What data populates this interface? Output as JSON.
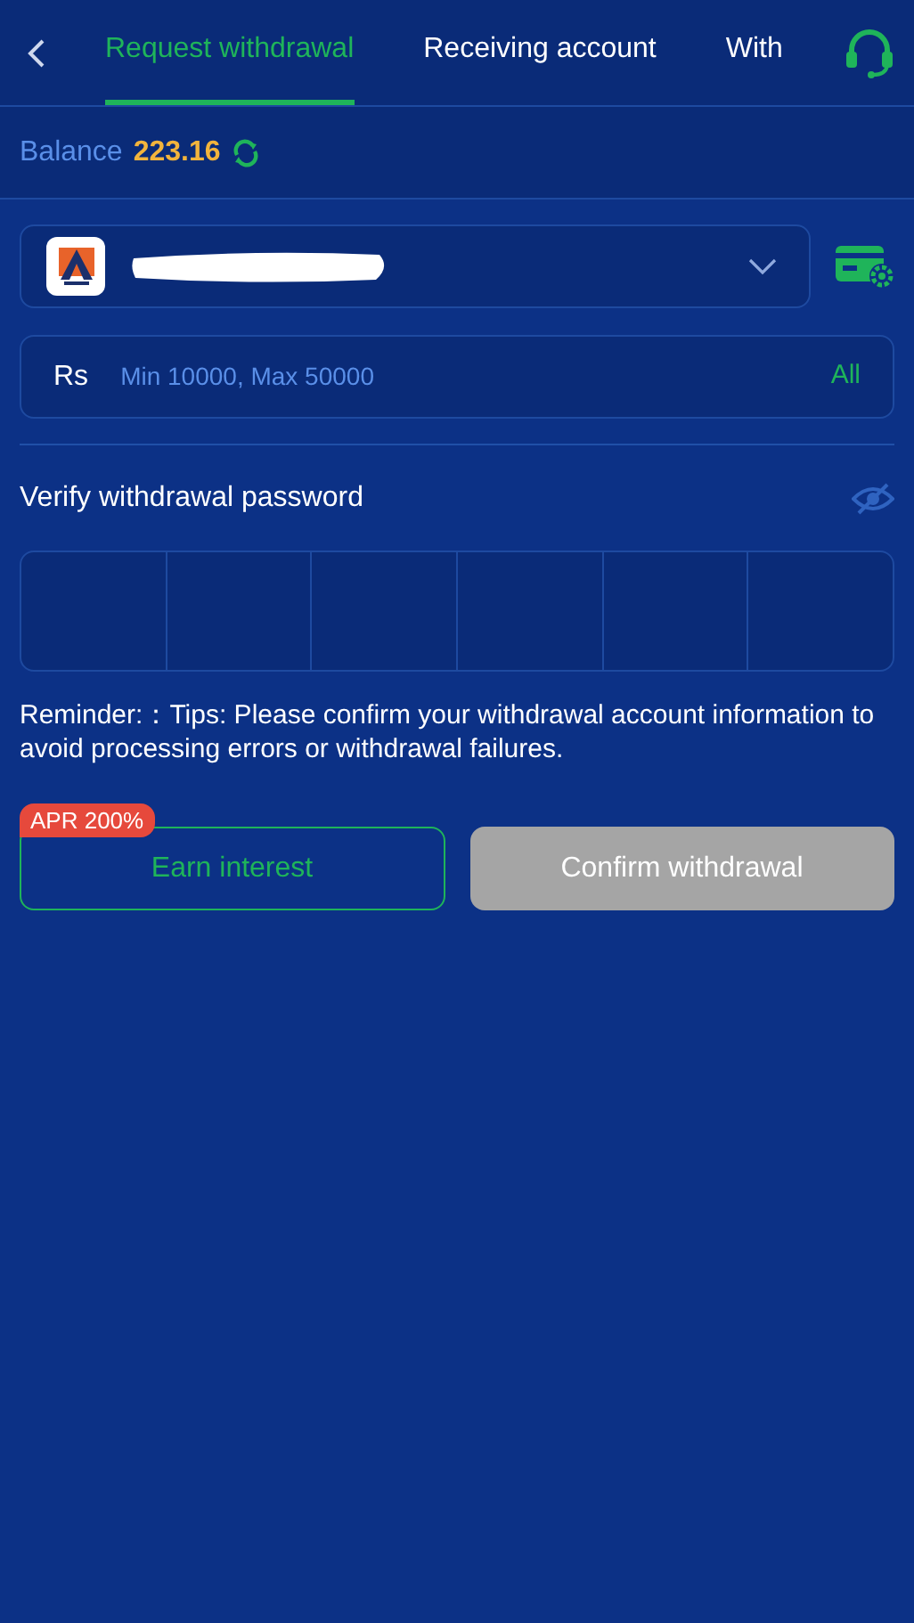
{
  "header": {
    "tabs": [
      {
        "label": "Request withdrawal",
        "selected": true
      },
      {
        "label": "Receiving account",
        "selected": false
      },
      {
        "label": "With",
        "selected": false
      }
    ]
  },
  "balance": {
    "label": "Balance",
    "amount": "223.16"
  },
  "account": {
    "redacted": true
  },
  "amount_field": {
    "currency": "Rs",
    "placeholder": "Min 10000, Max 50000",
    "all_label": "All"
  },
  "password": {
    "label": "Verify withdrawal password",
    "visible": false,
    "cells": [
      {
        "filled": false
      },
      {
        "filled": false
      },
      {
        "filled": false
      },
      {
        "filled": false
      },
      {
        "filled": false
      },
      {
        "filled": false
      }
    ]
  },
  "reminder": "Reminder:：Tips: Please confirm your withdrawal account information to avoid processing errors or withdrawal failures.",
  "earn": {
    "badge": "APR 200%",
    "label": "Earn interest"
  },
  "confirm": {
    "label": "Confirm withdrawal",
    "disabled": true
  }
}
